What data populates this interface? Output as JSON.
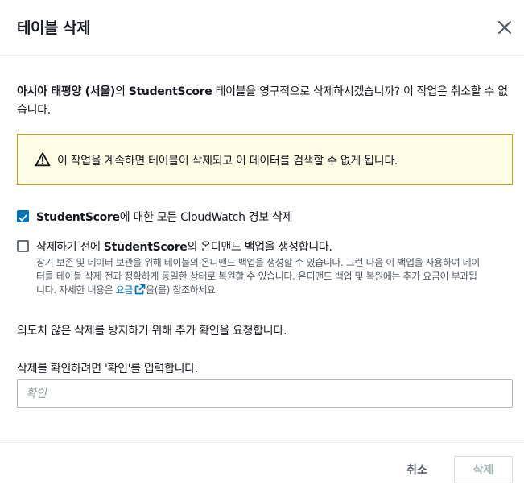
{
  "dialog": {
    "title": "테이블 삭제",
    "close_icon": "close-icon"
  },
  "message": {
    "region": "아시아 태평양 (서울)",
    "part1": "의 ",
    "table_name": "StudentScore",
    "part2": " 테이블을 영구적으로 삭제하시겠습니까? 이 작업은 취소할 수 없습니다."
  },
  "alert": {
    "icon": "warning-icon",
    "text": "이 작업을 계속하면 테이블이 삭제되고 이 데이터를 검색할 수 없게 됩니다."
  },
  "option_alarms": {
    "checked": true,
    "table_name": "StudentScore",
    "label_rest": "에 대한 모든 CloudWatch 경보 삭제"
  },
  "option_backup": {
    "checked": false,
    "label_prefix": "삭제하기 전에 ",
    "table_name": "StudentScore",
    "label_suffix": "의 온디맨드 백업을 생성합니다.",
    "desc_line1": "장기 보존 및 데이터 보관을 위해 테이블의 온디맨드 백업을 생성할 수 있습니다. 그런 다음 이 백업을 사용하여 데이",
    "desc_line2": "터를 테이블 삭제 전과 정확하게 동일한 상태로 복원할 수 있습니다. 온디맨드 백업 및 복원에는 추가 요금이 부과됩",
    "desc_line3_pre": "니다. 자세한 내용은 ",
    "link_text": "요금",
    "link_icon": "external-link-icon",
    "desc_line3_post": "을(를) 참조하세요."
  },
  "confirm": {
    "notice": "의도치 않은 삭제를 방지하기 위해 추가 확인을 요청합니다.",
    "label": "삭제를 확인하려면 '확인'를 입력합니다.",
    "placeholder": "확인",
    "value": ""
  },
  "footer": {
    "cancel_label": "취소",
    "delete_label": "삭제"
  },
  "colors": {
    "accent": "#0073bb",
    "warning_bg": "#fffce5",
    "warning_border": "#d3a10b"
  }
}
